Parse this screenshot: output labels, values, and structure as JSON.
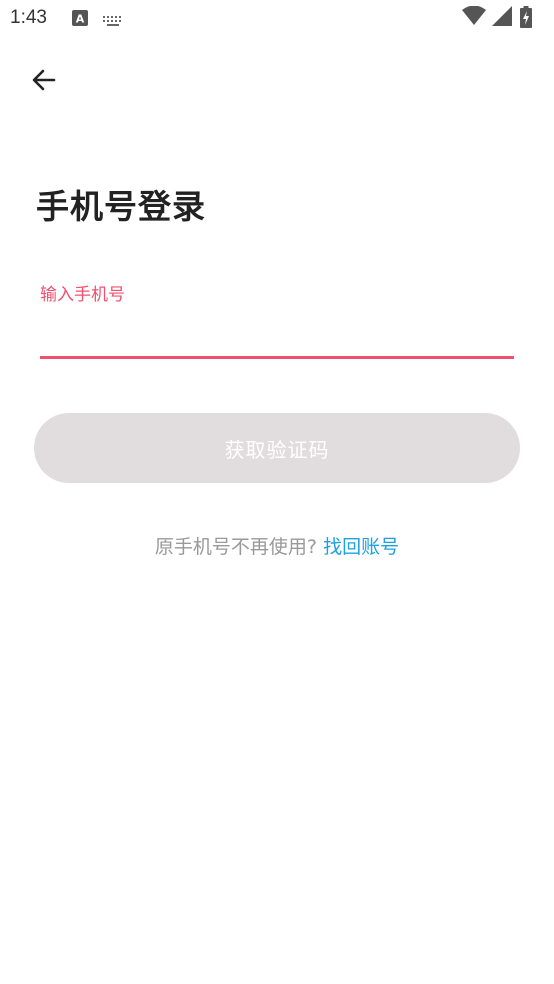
{
  "status_bar": {
    "time": "1:43",
    "icons": [
      "keyboard-a-icon",
      "keyboard-icon",
      "wifi-icon",
      "signal-icon",
      "battery-charging-icon"
    ]
  },
  "header": {
    "back_icon": "arrow-left-icon"
  },
  "login": {
    "title": "手机号登录",
    "phone_label": "输入手机号",
    "phone_value": "",
    "get_code_button": "获取验证码",
    "accent_color": "#f0506e",
    "button_color": "#e1dcdd"
  },
  "footer": {
    "prompt": "原手机号不再使用?",
    "link": "找回账号",
    "link_color": "#1ea1e0"
  }
}
